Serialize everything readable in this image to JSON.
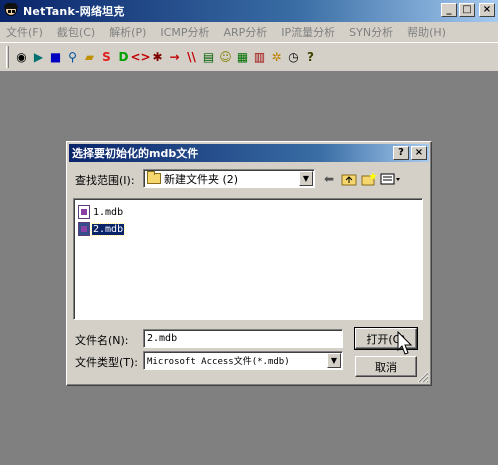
{
  "window": {
    "title": "NetTank-网络坦克",
    "buttons": {
      "minimize": "_",
      "maximize": "□",
      "close": "×"
    }
  },
  "menu": [
    "文件(F)",
    "截包(C)",
    "解析(P)",
    "ICMP分析",
    "ARP分析",
    "IP流量分析",
    "SYN分析",
    "帮助(H)"
  ],
  "toolbar": {
    "items": [
      {
        "icon": "target-icon",
        "glyph": "◉",
        "color": "#000000"
      },
      {
        "icon": "capture-icon",
        "glyph": "▶",
        "color": "#007070"
      },
      {
        "icon": "stop-icon",
        "glyph": "■",
        "color": "#0000c0"
      },
      {
        "icon": "search-icon",
        "glyph": "⚲",
        "color": "#0050a0"
      },
      {
        "icon": "folder-icon",
        "glyph": "▰",
        "color": "#c09000"
      },
      {
        "icon": "s-icon",
        "glyph": "S",
        "color": "#e02020"
      },
      {
        "icon": "d-icon",
        "glyph": "D",
        "color": "#00a000"
      },
      {
        "icon": "code-icon",
        "glyph": "<>",
        "color": "#c00000"
      },
      {
        "icon": "virus-icon",
        "glyph": "✱",
        "color": "#800000"
      },
      {
        "icon": "arrow-icon",
        "glyph": "→",
        "color": "#c00000"
      },
      {
        "icon": "slash-icon",
        "glyph": "\\\\",
        "color": "#c00000"
      },
      {
        "icon": "book-icon",
        "glyph": "▤",
        "color": "#006000"
      },
      {
        "icon": "smiley-icon",
        "glyph": "☺",
        "color": "#808000"
      },
      {
        "icon": "report-icon",
        "glyph": "▦",
        "color": "#007000"
      },
      {
        "icon": "chart-icon",
        "glyph": "▥",
        "color": "#a00000"
      },
      {
        "icon": "syn-icon",
        "glyph": "✲",
        "color": "#c08000"
      },
      {
        "icon": "clock-icon",
        "glyph": "◷",
        "color": "#000000"
      },
      {
        "icon": "help-icon",
        "glyph": "?",
        "color": "#404000"
      }
    ]
  },
  "dialog": {
    "title": "选择要初始化的mdb文件",
    "help_btn": "?",
    "close_btn": "×",
    "look_in_label": "查找范围(I):",
    "look_in_value": "新建文件夹 (2)",
    "files": [
      {
        "name": "1.mdb",
        "selected": false
      },
      {
        "name": "2.mdb",
        "selected": true
      }
    ],
    "filename_label": "文件名(N):",
    "filename_value": "2.mdb",
    "filetype_label": "文件类型(T):",
    "filetype_value": "Microsoft Access文件(*.mdb)",
    "open_button": "打开(O)",
    "cancel_button": "取消"
  }
}
